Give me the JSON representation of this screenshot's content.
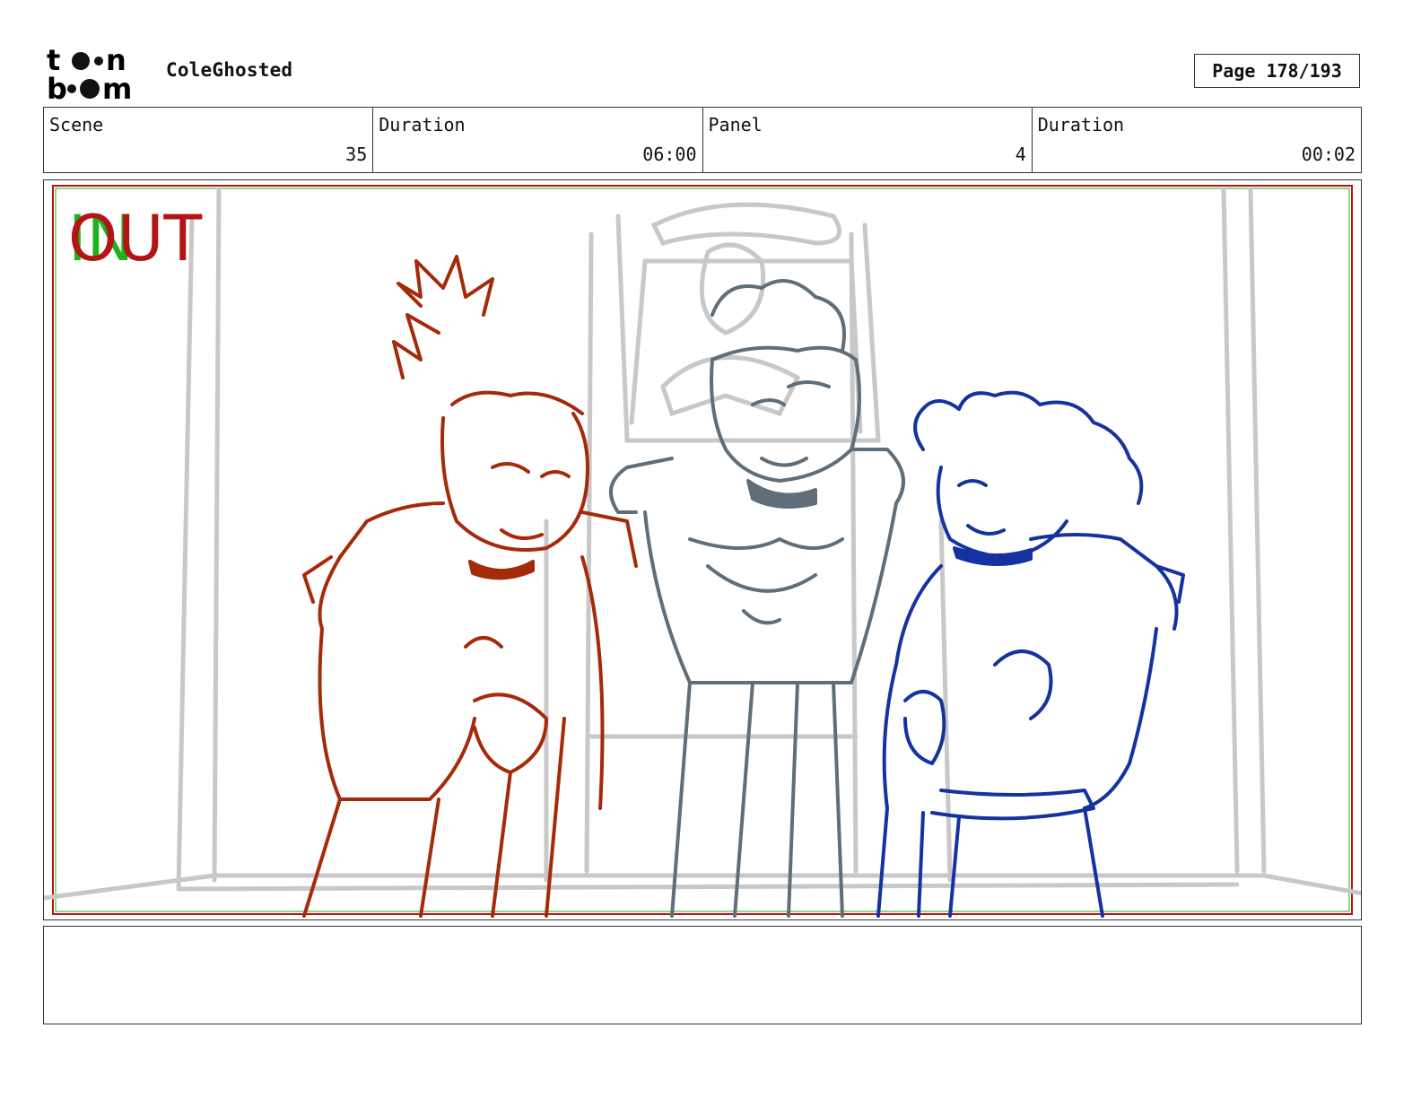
{
  "header": {
    "logo_name": "toon-boom-logo",
    "project_title": "ColeGhosted",
    "page_label": "Page",
    "page_number": "178/193"
  },
  "info": {
    "scene_label": "Scene",
    "scene_value": "35",
    "scene_duration_label": "Duration",
    "scene_duration_value": "06:00",
    "panel_label": "Panel",
    "panel_value": "4",
    "panel_duration_label": "Duration",
    "panel_duration_value": "00:02"
  },
  "panel": {
    "in_marker": "IN",
    "out_marker": "OUT",
    "colors": {
      "in_green": "#1db31d",
      "out_red": "#b51414",
      "character_left": "#a52a0a",
      "character_middle": "#5f6e78",
      "character_right": "#1533a0",
      "background_lines": "#c8c8c8"
    }
  },
  "notes": {
    "text": ""
  }
}
